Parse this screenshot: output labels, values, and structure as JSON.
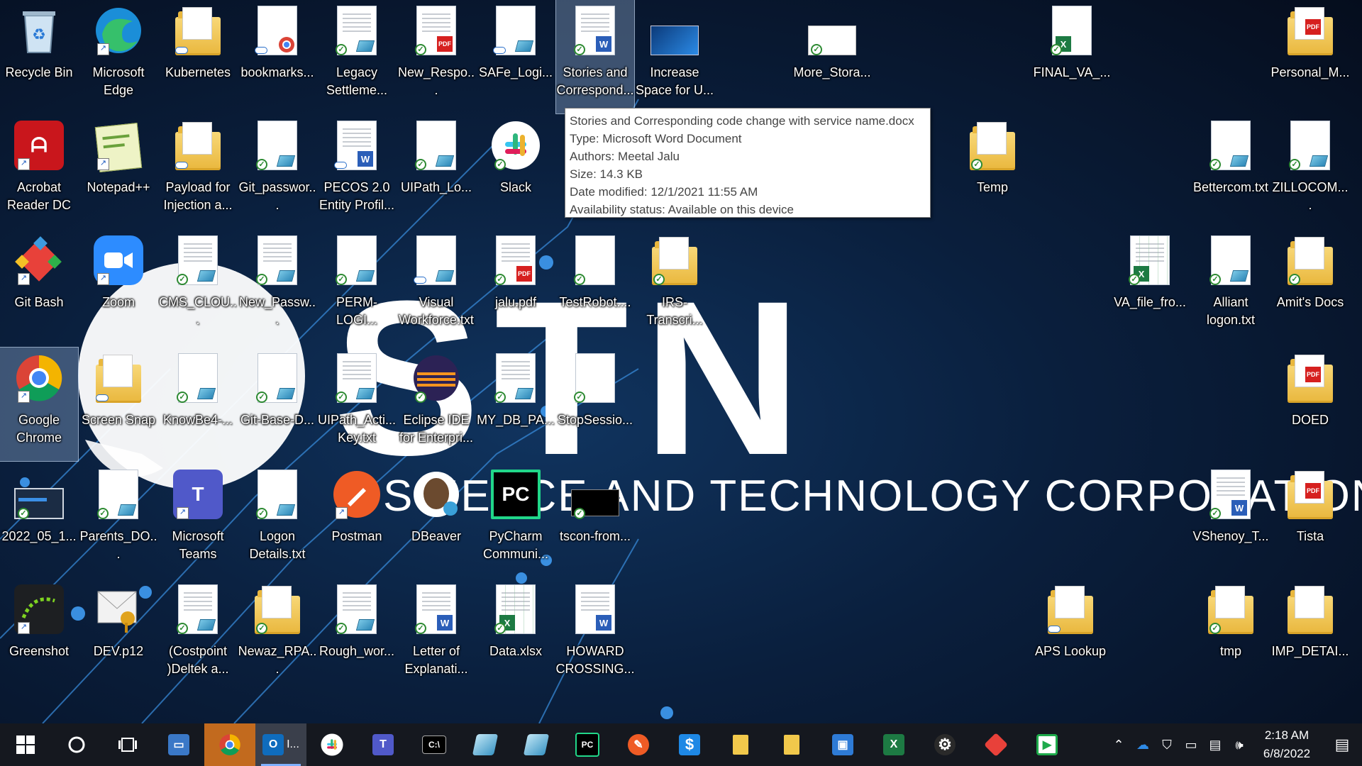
{
  "wallpaper": {
    "logo_big": "STN",
    "logo_tagline": "SCIENCE AND TECHNOLOGY CORPORATION"
  },
  "desktop": {
    "col1": [
      {
        "label": "Recycle Bin",
        "icon": "recycle-bin-icon"
      },
      {
        "label": "Acrobat Reader DC",
        "icon": "acrobat-icon"
      },
      {
        "label": "Git Bash",
        "icon": "git-icon"
      },
      {
        "label": "Google Chrome",
        "icon": "chrome-icon"
      },
      {
        "label": "2022_05_1...",
        "icon": "screenshot-file-icon"
      },
      {
        "label": "Greenshot",
        "icon": "greenshot-icon"
      }
    ],
    "col2": [
      {
        "label": "Microsoft Edge",
        "icon": "edge-icon"
      },
      {
        "label": "Notepad++",
        "icon": "notepadpp-icon"
      },
      {
        "label": "Zoom",
        "icon": "zoom-icon"
      },
      {
        "label": "Screen Snap",
        "icon": "folder-icon"
      },
      {
        "label": "Parents_DO...",
        "icon": "text-file-icon"
      },
      {
        "label": "DEV.p12",
        "icon": "certificate-icon"
      }
    ],
    "col3": [
      {
        "label": "Kubernetes",
        "icon": "folder-icon"
      },
      {
        "label": "Payload for Injection a...",
        "icon": "folder-icon"
      },
      {
        "label": "CMS_CLOU...",
        "icon": "text-file-icon"
      },
      {
        "label": "KnowBe4-...",
        "icon": "text-file-icon"
      },
      {
        "label": "Microsoft Teams",
        "icon": "teams-icon"
      },
      {
        "label": "(Costpoint )Deltek a...",
        "icon": "text-file-icon"
      }
    ],
    "col4": [
      {
        "label": "bookmarks...",
        "icon": "chrome-html-file-icon"
      },
      {
        "label": "Git_passwor...",
        "icon": "text-file-icon"
      },
      {
        "label": "New_Passw...",
        "icon": "text-file-icon"
      },
      {
        "label": "Git-Base-D...",
        "icon": "text-file-icon"
      },
      {
        "label": "Logon Details.txt",
        "icon": "text-file-icon"
      },
      {
        "label": "Newaz_RPA...",
        "icon": "folder-icon"
      }
    ],
    "col5": [
      {
        "label": "Legacy Settleme...",
        "icon": "text-file-icon"
      },
      {
        "label": "PECOS 2.0 Entity Profil...",
        "icon": "word-file-icon"
      },
      {
        "label": "PERM-LOGI...",
        "icon": "text-file-icon"
      },
      {
        "label": "UIPath_Acti... Key.txt",
        "icon": "text-file-icon"
      },
      {
        "label": "Postman",
        "icon": "postman-icon"
      },
      {
        "label": "Rough_wor...",
        "icon": "text-file-icon"
      }
    ],
    "col6": [
      {
        "label": "New_Respo... LC_Employ...",
        "icon": "pdf-file-icon"
      },
      {
        "label": "UIPath_Lo...",
        "icon": "text-file-icon"
      },
      {
        "label": "Visual Workforce.txt",
        "icon": "text-file-icon"
      },
      {
        "label": "Eclipse IDE for Enterpri...",
        "icon": "eclipse-icon"
      },
      {
        "label": "DBeaver",
        "icon": "dbeaver-icon"
      },
      {
        "label": "Letter of Explanati...",
        "icon": "word-file-icon"
      }
    ],
    "col7": [
      {
        "label": "SAFe_Logi...",
        "icon": "text-file-icon"
      },
      {
        "label": "Slack",
        "icon": "slack-icon"
      },
      {
        "label": "jalu.pdf",
        "icon": "pdf-file-icon"
      },
      {
        "label": "MY_DB_PA...",
        "icon": "text-file-icon"
      },
      {
        "label": "PyCharm Communi...",
        "icon": "pycharm-icon"
      },
      {
        "label": "Data.xlsx",
        "icon": "excel-file-icon"
      }
    ],
    "col8": [
      {
        "label": "Stories and Correspond...",
        "icon": "word-file-icon"
      },
      {
        "label": "TestRobot....",
        "icon": "blank-file-icon"
      },
      {
        "label": "StopSessio...",
        "icon": "blank-file-icon"
      },
      {
        "label": "tscon-from...",
        "icon": "cmd-file-icon"
      },
      {
        "label": "HOWARD CROSSING...",
        "icon": "word-file-icon"
      }
    ],
    "col9": [
      {
        "label": "Increase Space for U...",
        "icon": "screenshot-file-icon"
      },
      {
        "label": "IRS-Transcri...",
        "icon": "folder-icon"
      }
    ],
    "misc": [
      {
        "label": "More_Stora...",
        "icon": "image-file-icon"
      },
      {
        "label": "Temp",
        "icon": "folder-icon"
      },
      {
        "label": "FINAL_VA_...",
        "icon": "excel-file-icon"
      },
      {
        "label": "VA_file_fro...",
        "icon": "excel-file-icon"
      },
      {
        "label": "APS Lookup",
        "icon": "folder-icon"
      },
      {
        "label": "Bettercom.txt",
        "icon": "text-file-icon"
      },
      {
        "label": "Alliant logon.txt",
        "icon": "text-file-icon"
      },
      {
        "label": "VShenoy_T...",
        "icon": "word-file-icon"
      },
      {
        "label": "tmp",
        "icon": "folder-icon"
      },
      {
        "label": "Personal_M...",
        "icon": "pdf-folder-icon"
      },
      {
        "label": "ZILLOCOM....",
        "icon": "text-file-icon"
      },
      {
        "label": "Amit's Docs",
        "icon": "folder-icon"
      },
      {
        "label": "DOED",
        "icon": "pdf-folder-icon"
      },
      {
        "label": "Tista",
        "icon": "pdf-folder-icon"
      },
      {
        "label": "IMP_DETAI...",
        "icon": "folder-icon"
      }
    ]
  },
  "tooltip": {
    "line1": "Stories and Corresponding code change with service name.docx",
    "line2": "Type: Microsoft Word Document",
    "line3": "Authors: Meetal Jalu",
    "line4": "Size: 14.3 KB",
    "line5": "Date modified: 12/1/2021 11:55 AM",
    "line6": "Availability status: Available on this device"
  },
  "taskbar": {
    "outlook_label": "I...",
    "time": "2:18 AM",
    "date": "6/8/2022"
  },
  "colors": {
    "accent": "#7fb0ff",
    "taskbar_bg": "#15181f",
    "word": "#2b5eb8",
    "excel": "#1d7a43",
    "pdf": "#d6201f"
  }
}
